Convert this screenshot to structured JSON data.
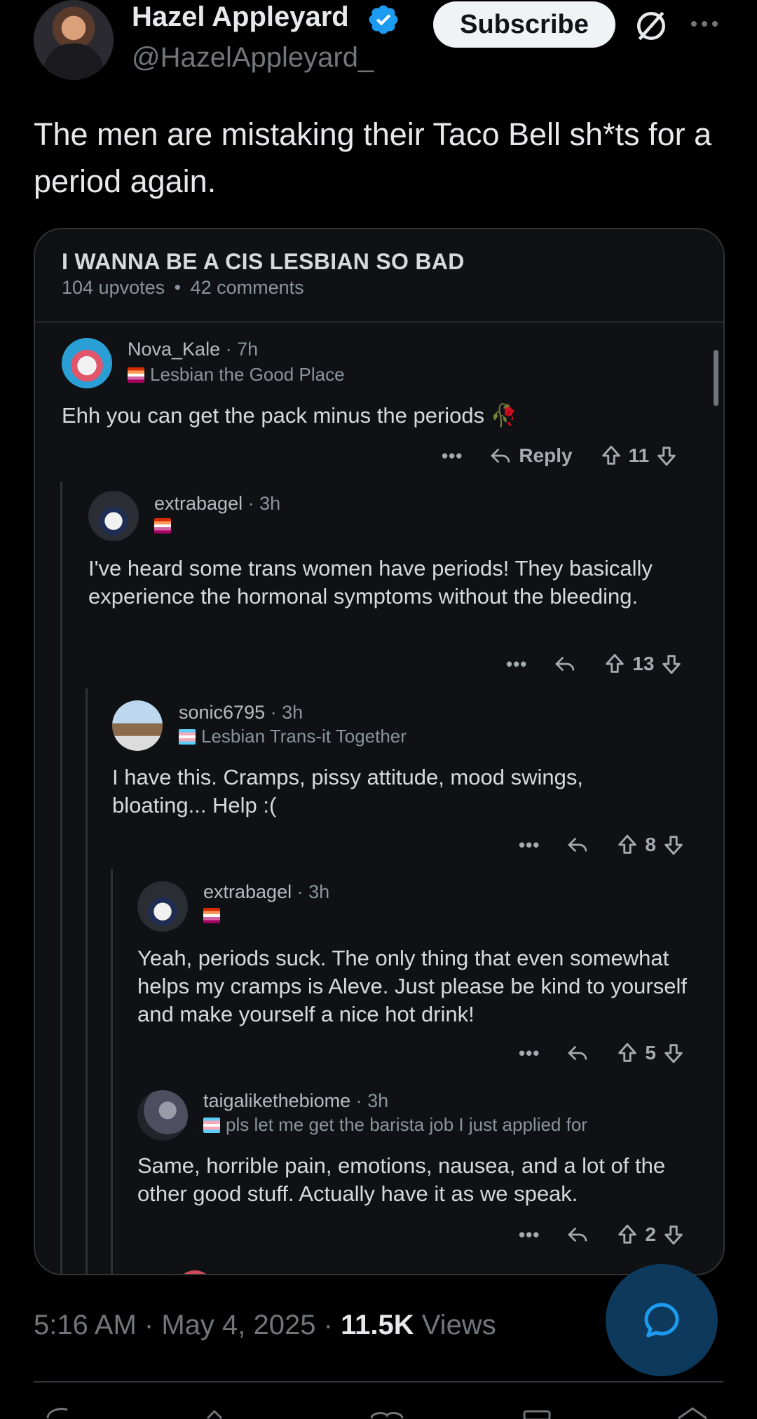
{
  "header": {
    "display_name": "Hazel Appleyard",
    "handle": "@HazelAppleyard_",
    "subscribe_label": "Subscribe",
    "verified_color": "#1d9bf0"
  },
  "tweet": {
    "text": "The men are mistaking their Taco Bell sh*ts for a period again."
  },
  "card": {
    "title": "I WANNA BE A CIS LESBIAN SO BAD",
    "upvotes": "104 upvotes",
    "comments": "42 comments",
    "meta_sep": "•",
    "comments_list": [
      {
        "user": "Nova_Kale",
        "time": "7h",
        "flair": "Lesbian the Good Place",
        "flag": "lesbian",
        "body": "Ehh you can get the pack minus the periods 🥀",
        "reply_label": "Reply",
        "votes": "11"
      },
      {
        "user": "extrabagel",
        "time": "3h",
        "flair": "",
        "flag": "lesbian",
        "body": "I've heard some trans women have periods! They basically experience the hormonal symptoms without the bleeding.",
        "votes": "13"
      },
      {
        "user": "sonic6795",
        "time": "3h",
        "flair": "Lesbian Trans-it Together",
        "flag": "trans",
        "body": "I have this. Cramps, pissy attitude, mood swings, bloating... Help :(",
        "votes": "8"
      },
      {
        "user": "extrabagel",
        "time": "3h",
        "flair": "",
        "flag": "lesbian",
        "body": "Yeah, periods suck. The only thing that even somewhat helps my cramps is Aleve. Just please be kind to yourself and make yourself a nice hot drink!",
        "votes": "5"
      },
      {
        "user": "taigalikethebiome",
        "time": "3h",
        "flair": "pls let me get the barista job I just applied for",
        "flag": "trans",
        "body": "Same, horrible pain, emotions, nausea, and a lot of the other good stuff. Actually have it as we speak.",
        "votes": "2"
      }
    ]
  },
  "footer": {
    "time": "5:16 AM",
    "date": "May 4, 2025",
    "sep": "·",
    "views_count": "11.5K",
    "views_label": "Views"
  }
}
